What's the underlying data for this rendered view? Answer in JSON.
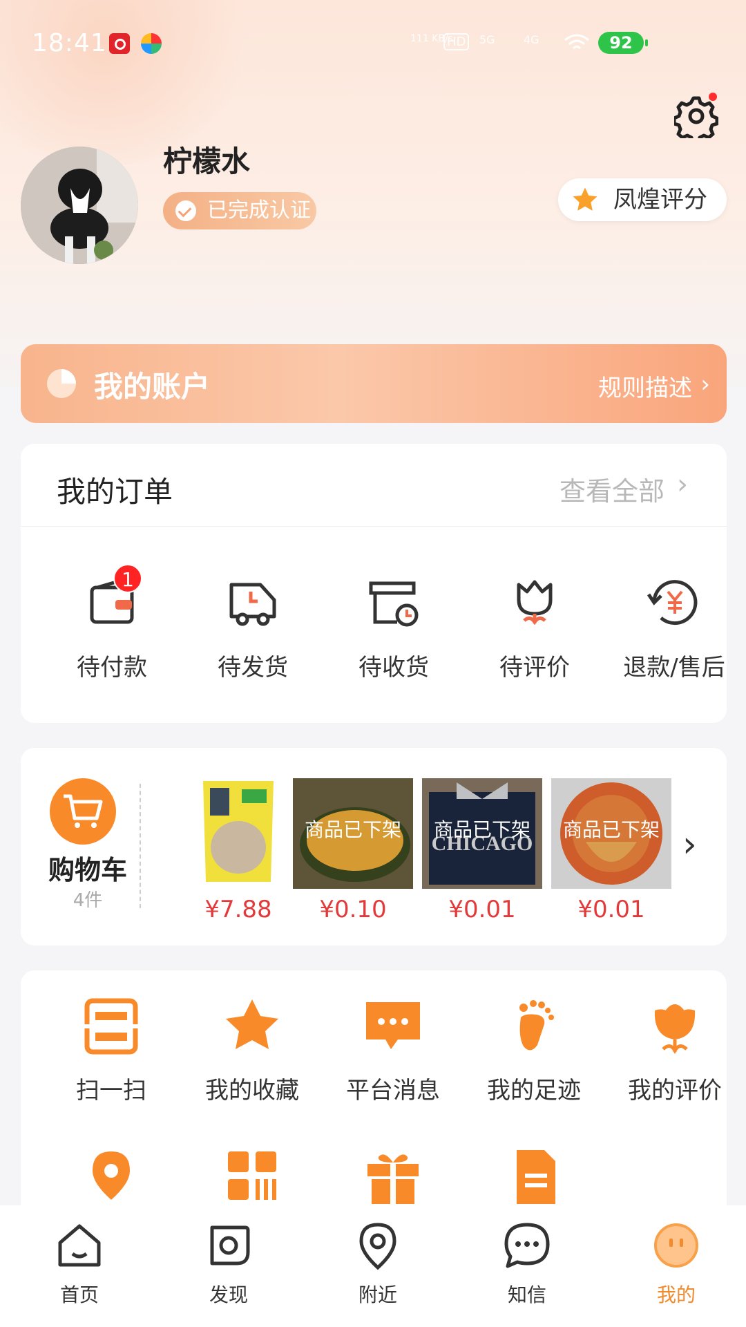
{
  "status_bar": {
    "time": "18:41",
    "speed": "111\nKB/s",
    "hd": "HD",
    "net1": "5G",
    "net2": "4G",
    "battery": "92"
  },
  "profile": {
    "username": "柠檬水",
    "verified_label": "已完成认证",
    "score_label": "凤煌评分"
  },
  "account": {
    "title": "我的账户",
    "rule_label": "规则描述"
  },
  "orders": {
    "title": "我的订单",
    "view_all": "查看全部",
    "items": [
      {
        "label": "待付款",
        "icon": "wallet-icon",
        "badge": "1"
      },
      {
        "label": "待发货",
        "icon": "delivery-truck-icon"
      },
      {
        "label": "待收货",
        "icon": "package-clock-icon"
      },
      {
        "label": "待评价",
        "icon": "tulip-icon"
      },
      {
        "label": "退款/售后",
        "icon": "refund-icon"
      }
    ]
  },
  "cart": {
    "label": "购物车",
    "count": "4件",
    "products": [
      {
        "price": "¥7.88",
        "off_label": ""
      },
      {
        "price": "¥0.10",
        "off_label": "商品已下架"
      },
      {
        "price": "¥0.01",
        "off_label": "商品已下架"
      },
      {
        "price": "¥0.01",
        "off_label": "商品已下架"
      }
    ]
  },
  "tools": {
    "row1": [
      {
        "label": "扫一扫",
        "icon": "scan-icon"
      },
      {
        "label": "我的收藏",
        "icon": "star-icon"
      },
      {
        "label": "平台消息",
        "icon": "message-icon"
      },
      {
        "label": "我的足迹",
        "icon": "footprint-icon"
      },
      {
        "label": "我的评价",
        "icon": "tulip-icon"
      }
    ],
    "row2_icons": [
      "location-icon",
      "qrcode-icon",
      "gift-icon",
      "document-icon"
    ]
  },
  "nav": {
    "items": [
      {
        "label": "首页",
        "icon": "home-icon"
      },
      {
        "label": "发现",
        "icon": "discover-icon"
      },
      {
        "label": "附近",
        "icon": "location-pin-icon"
      },
      {
        "label": "知信",
        "icon": "chat-icon"
      },
      {
        "label": "我的",
        "icon": "profile-face-icon"
      }
    ],
    "active_index": 4
  },
  "colors": {
    "accent": "#f28a2e",
    "price": "#e23a3a",
    "badge": "#ff2323"
  }
}
